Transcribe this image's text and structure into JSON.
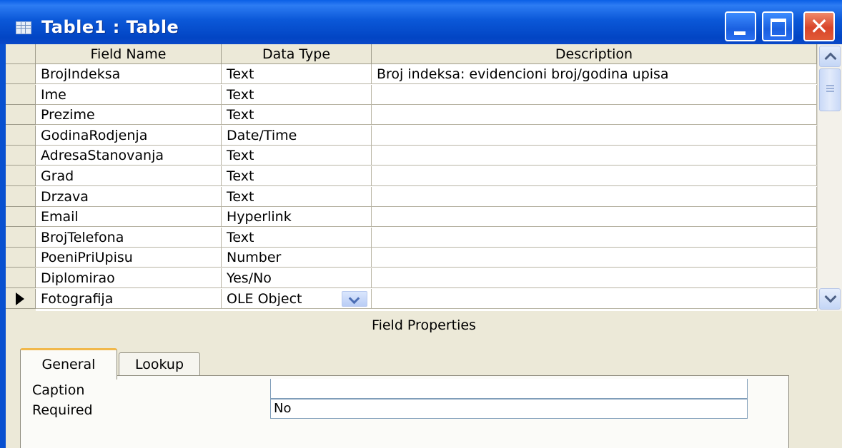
{
  "window": {
    "title": "Table1 : Table"
  },
  "grid": {
    "columns": [
      "Field Name",
      "Data Type",
      "Description"
    ],
    "rows": [
      {
        "field": "BrojIndeksa",
        "type": "Text",
        "description": "Broj indeksa: evidencioni broj/godina upisa"
      },
      {
        "field": "Ime",
        "type": "Text",
        "description": ""
      },
      {
        "field": "Prezime",
        "type": "Text",
        "description": ""
      },
      {
        "field": "GodinaRodjenja",
        "type": "Date/Time",
        "description": ""
      },
      {
        "field": "AdresaStanovanja",
        "type": "Text",
        "description": ""
      },
      {
        "field": "Grad",
        "type": "Text",
        "description": ""
      },
      {
        "field": "Drzava",
        "type": "Text",
        "description": ""
      },
      {
        "field": "Email",
        "type": "Hyperlink",
        "description": ""
      },
      {
        "field": "BrojTelefona",
        "type": "Text",
        "description": ""
      },
      {
        "field": "PoeniPriUpisu",
        "type": "Number",
        "description": ""
      },
      {
        "field": "Diplomirao",
        "type": "Yes/No",
        "description": ""
      },
      {
        "field": "Fotografija",
        "type": "OLE Object",
        "description": ""
      }
    ],
    "current_row": 11
  },
  "field_properties": {
    "label": "Field Properties",
    "tabs": [
      "General",
      "Lookup"
    ],
    "active_tab": "General",
    "properties": [
      {
        "label": "Caption",
        "value": ""
      },
      {
        "label": "Required",
        "value": "No"
      }
    ]
  },
  "colors": {
    "title_bar": "#0b58d8",
    "close_button": "#d8452a",
    "dialog_bg": "#ece9d8"
  }
}
